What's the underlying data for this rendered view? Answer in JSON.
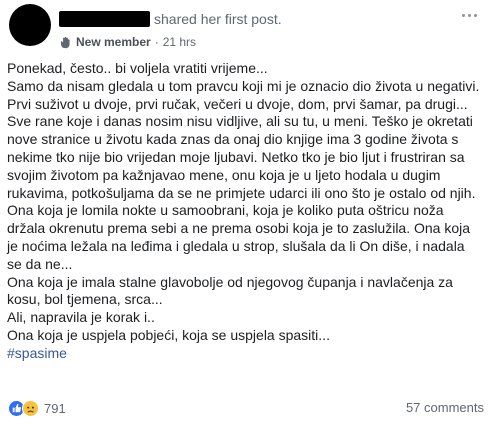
{
  "post": {
    "header": {
      "author_action": "shared her first post.",
      "badge_label": "New member",
      "separator": "·",
      "time": "21 hrs"
    },
    "lines": [
      "Ponekad, često.. bi voljela vratiti vrijeme...",
      "Samo da nisam gledala u tom pravcu koji mi je oznacio dio života u negativi.",
      "Prvi suživot u dvoje, prvi ručak, večeri u dvoje, dom, prvi šamar, pa drugi...",
      "Sve rane koje i danas nosim nisu vidljive, ali su tu, u meni. Teško je okretati",
      "nove stranice u životu kada znas da onaj dio knjige ima 3 godine života s",
      "nekime tko nije bio vrijedan moje ljubavi. Netko tko je bio ljut i frustriran sa",
      "svojim životom pa kažnjavao mene, onu koja je u ljeto hodala u dugim",
      "rukavima, potkošuljama da se ne primjete udarci ili ono što je ostalo od njih.",
      "Ona koja je lomila nokte u samoobrani, koja je koliko puta oštricu noža",
      "držala okrenutu prema sebi a ne prema osobi koja je to zaslužila. Ona koja",
      "je noćima ležala na leđima i gledala u strop, slušala da li On diše, i nadala",
      "se da ne...",
      "Ona koja je imala stalne glavobolje od njegovog čupanja i navlačenja za",
      "kosu, bol tjemena, srca...",
      "Ali, napravila je korak i..",
      "Ona koja je uspjela pobjeći, koja se uspjela spasiti..."
    ],
    "hashtag": "#spasime",
    "reactions": {
      "icons": [
        "like-icon",
        "sad-icon"
      ],
      "count": "791"
    },
    "comments": "57 comments"
  },
  "colors": {
    "link": "#385898",
    "meta": "#606770",
    "like": "#2f6ef2",
    "sad": "#f7c23e"
  }
}
